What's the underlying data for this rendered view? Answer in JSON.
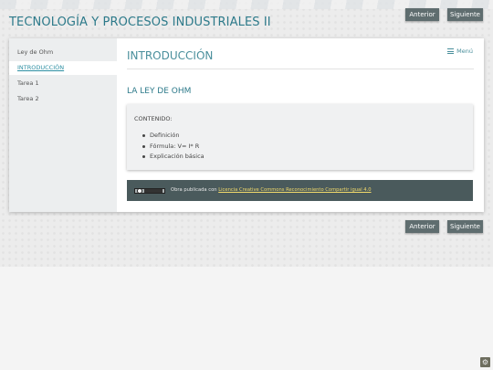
{
  "header": {
    "site_title": "TECNOLOGÍA Y PROCESOS INDUSTRIALES II"
  },
  "nav": {
    "prev_label": "Anterior",
    "next_label": "Siguiente"
  },
  "sidebar": {
    "items": [
      {
        "label": "Ley de Ohm",
        "active": false
      },
      {
        "label": "INTRODUCCIÓN",
        "active": true
      },
      {
        "label": "Tarea 1",
        "active": false
      },
      {
        "label": "Tarea 2",
        "active": false
      }
    ]
  },
  "main": {
    "page_title": "INTRODUCCIÓN",
    "menu_label": "Menú",
    "section_title": "LA LEY DE OHM",
    "content_label": "CONTENIDO:",
    "content_items": [
      "Definición",
      "Fórmula: V= I* R",
      "Explicación básica"
    ]
  },
  "footer": {
    "prefix": "Obra publicada con ",
    "license_link": "Licencia Creative Commons Reconocimiento Compartir igual 4.0"
  },
  "icons": {
    "menu": "hamburger-icon",
    "license": "cc-by-sa-badge",
    "corner": "settings-icon"
  },
  "colors": {
    "accent": "#2d7a8a",
    "button": "#5f6d6f",
    "footer_bar": "#4a5a5c",
    "link_yellow": "#f0d86a"
  }
}
